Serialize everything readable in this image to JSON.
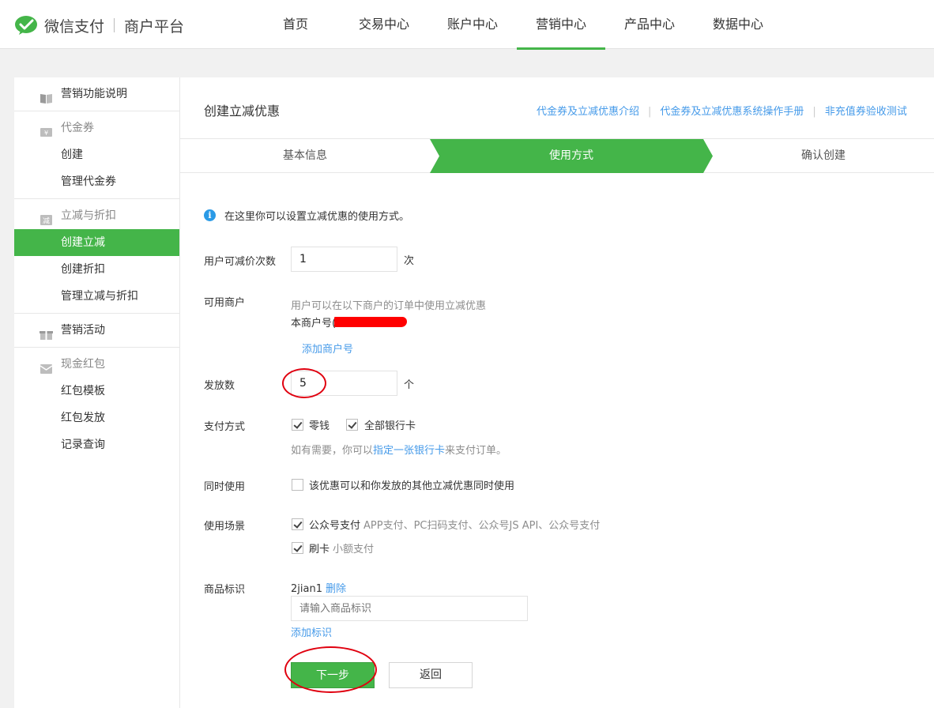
{
  "brand": {
    "name": "微信支付",
    "sub": "商户平台",
    "color": "#44b549"
  },
  "nav": [
    "首页",
    "交易中心",
    "账户中心",
    "营销中心",
    "产品中心",
    "数据中心"
  ],
  "nav_active": "营销中心",
  "sidebar": {
    "top_item": {
      "label": "营销功能说明",
      "icon": "book-icon"
    },
    "voucher": {
      "title": "代金券",
      "icon": "coupon-icon",
      "items": [
        "创建",
        "管理代金券"
      ]
    },
    "discount": {
      "title": "立减与折扣",
      "icon": "discount-icon",
      "items": [
        "创建立减",
        "创建折扣",
        "管理立减与折扣"
      ],
      "active": "创建立减"
    },
    "activity": {
      "label": "营销活动",
      "icon": "gift-icon"
    },
    "redpack": {
      "title": "现金红包",
      "icon": "redpack-icon",
      "items": [
        "红包模板",
        "红包发放",
        "记录查询"
      ]
    }
  },
  "main": {
    "title": "创建立减优惠",
    "help_links": [
      "代金券及立减优惠介绍",
      "代金券及立减优惠系统操作手册",
      "非充值券验收测试"
    ],
    "steps": [
      "基本信息",
      "使用方式",
      "确认创建"
    ],
    "active_step": "使用方式",
    "info": "在这里你可以设置立减优惠的使用方式。",
    "form": {
      "limit_label": "用户可减价次数",
      "limit_value": "1",
      "limit_unit": "次",
      "merchant_label": "可用商户",
      "merchant_hint": "用户可以在以下商户的订单中使用立减优惠",
      "merchant_value": "本商户号(",
      "add_merchant": "添加商户号",
      "count_label": "发放数",
      "count_value": "5",
      "count_unit": "个",
      "pay_label": "支付方式",
      "pay_options": [
        {
          "label": "零钱",
          "checked": true
        },
        {
          "label": "全部银行卡",
          "checked": true
        }
      ],
      "pay_hint_pre": "如有需要，你可以",
      "pay_hint_link": "指定一张银行卡",
      "pay_hint_post": "来支付订单。",
      "concurrent_label": "同时使用",
      "concurrent_option": {
        "label": "该优惠可以和你发放的其他立减优惠同时使用",
        "checked": false
      },
      "scene_label": "使用场景",
      "scene_options": [
        {
          "label": "公众号支付",
          "sub": "APP支付、PC扫码支付、公众号JS API、公众号支付",
          "checked": true
        },
        {
          "label": "刷卡",
          "sub": "小额支付",
          "checked": true
        }
      ],
      "goods_label": "商品标识",
      "goods_tag": "2jian1",
      "goods_delete": "删除",
      "goods_placeholder": "请输入商品标识",
      "goods_add": "添加标识"
    },
    "buttons": {
      "next": "下一步",
      "back": "返回"
    }
  }
}
